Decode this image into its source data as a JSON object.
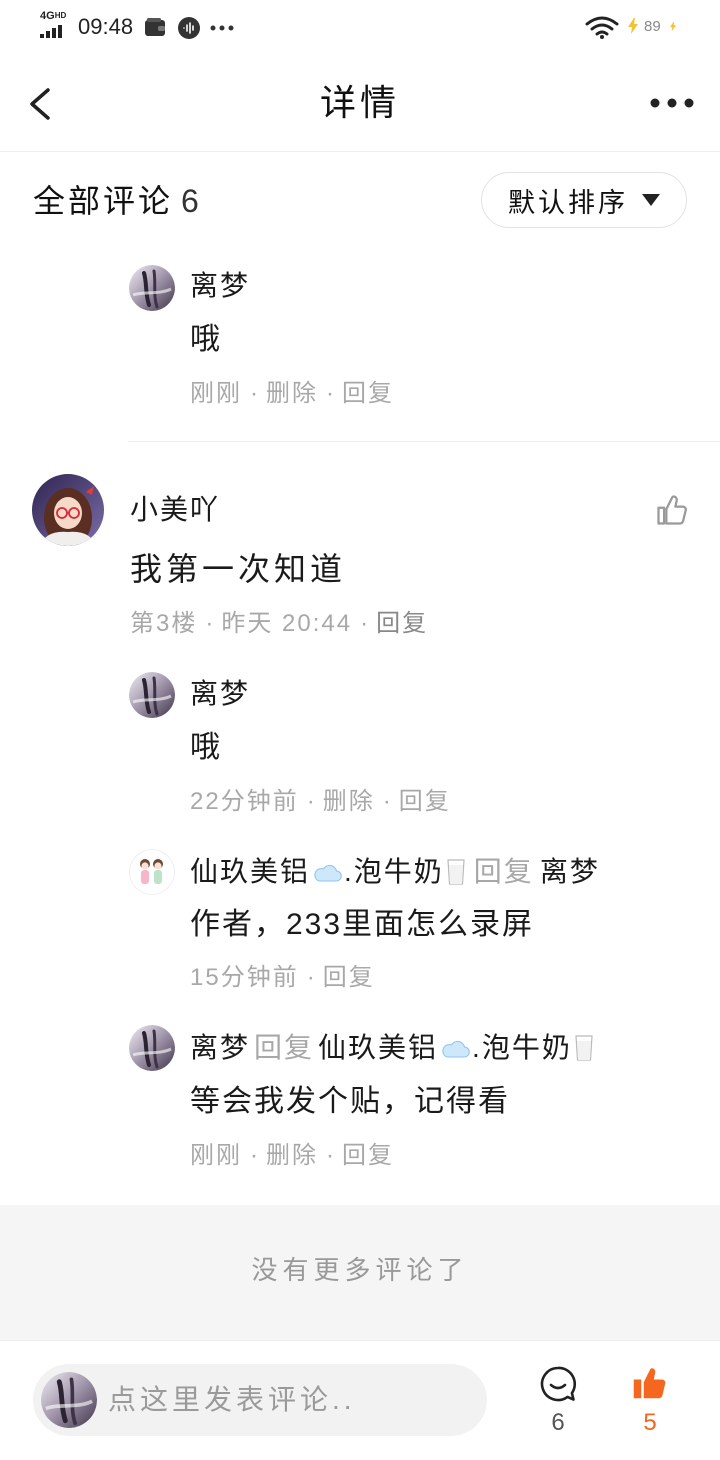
{
  "status_bar": {
    "network": "4G",
    "network_tag": "HD",
    "time": "09:48",
    "battery": "89"
  },
  "header": {
    "title": "详情",
    "back_icon": "chevron-left-icon",
    "menu_icon": "more-dots-icon"
  },
  "comments_header": {
    "label": "全部评论",
    "count": "6",
    "sort_label": "默认排序"
  },
  "ui": {
    "separator": "·"
  },
  "top_replies": [
    {
      "author": "离梦",
      "text": "哦",
      "time": "刚刚",
      "delete": "删除",
      "reply": "回复"
    }
  ],
  "comment": {
    "author": "小美吖",
    "text": "我第一次知道",
    "floor": "第3楼",
    "time": "昨天 20:44",
    "reply": "回复",
    "replies": [
      {
        "author": "离梦",
        "text": "哦",
        "time": "22分钟前",
        "delete": "删除",
        "reply": "回复"
      },
      {
        "author": {
          "part1": "仙玖美铝",
          "emoji1": "cloud-icon",
          "part2": ".泡牛奶",
          "emoji2": "milk-glass-icon"
        },
        "reply_word": "回复",
        "target": "离梦",
        "text": "作者，233里面怎么录屏",
        "time": "15分钟前",
        "reply": "回复"
      },
      {
        "author": "离梦",
        "reply_word": "回复",
        "target": {
          "part1": "仙玖美铝",
          "emoji1": "cloud-icon",
          "part2": ".泡牛奶",
          "emoji2": "milk-glass-icon"
        },
        "text": "等会我发个贴，记得看",
        "time": "刚刚",
        "delete": "删除",
        "reply": "回复"
      }
    ]
  },
  "footer": {
    "no_more": "没有更多评论了"
  },
  "bottom_bar": {
    "placeholder": "点这里发表评论..",
    "comment_count": "6",
    "like_count": "5"
  },
  "colors": {
    "accent": "#f5661f",
    "text": "#1a1a1a",
    "meta": "#a8a8a8",
    "divider": "#eeeeee",
    "footer_bg": "#f5f5f5",
    "input_bg": "#f2f2f2"
  }
}
